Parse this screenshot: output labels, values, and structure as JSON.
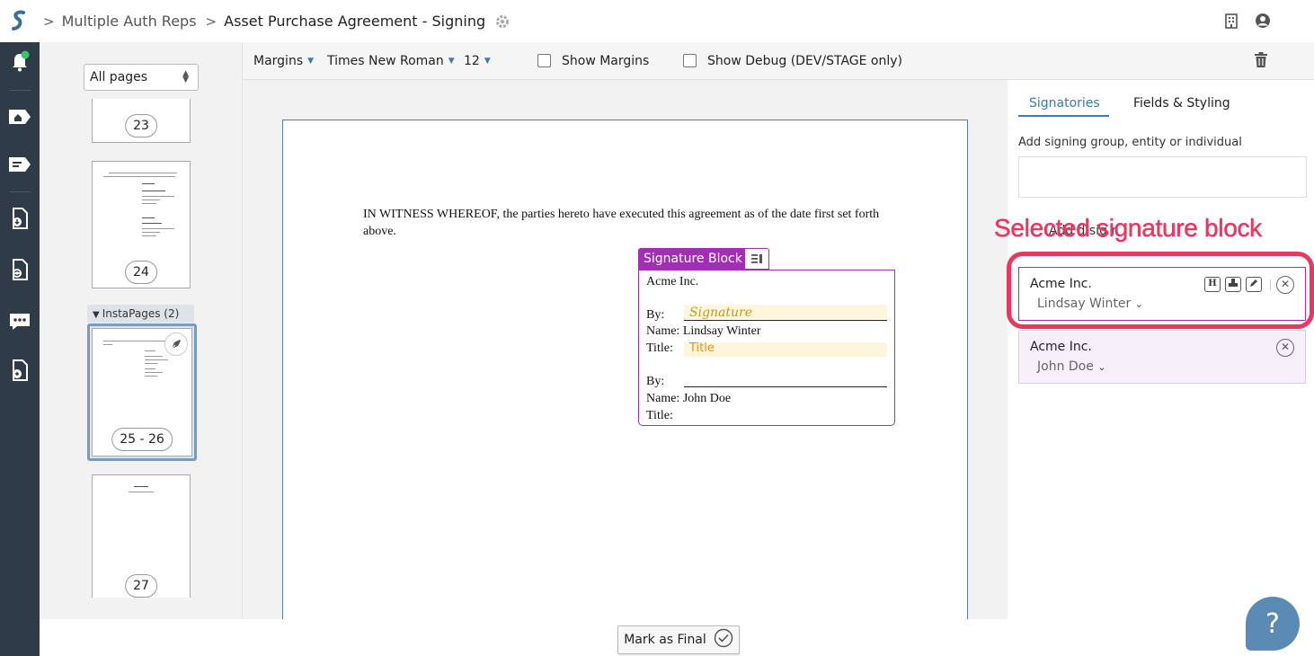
{
  "header": {
    "breadcrumb": [
      "Multiple Auth Reps",
      "Asset Purchase Agreement - Signing"
    ],
    "separator": ">"
  },
  "thumbnails": {
    "page_filter": "All pages",
    "pages": [
      "23",
      "24",
      "25 - 26",
      "27"
    ],
    "instapages_label": "InstaPages (2)"
  },
  "toolbar": {
    "margins": "Margins",
    "font": "Times New Roman",
    "size": "12",
    "show_margins": "Show Margins",
    "show_debug": "Show Debug (DEV/STAGE only)"
  },
  "document": {
    "witness": "IN WITNESS WHEREOF, the parties hereto have executed this agreement as of the date first set forth above.",
    "block_label": "Signature Block",
    "entity": "Acme Inc.",
    "by": "By:",
    "signature_placeholder": "Signature",
    "name1": "Name: Lindsay Winter",
    "title_label": "Title:",
    "title_placeholder": "Title",
    "name2": "Name: John Doe"
  },
  "actions": {
    "mark_final": "Mark as Final"
  },
  "right_panel": {
    "tabs": [
      "Signatories",
      "Fields & Styling"
    ],
    "add_label": "Add signing group, entity or individual",
    "obscured_text": "Add d sig r",
    "signers": [
      {
        "entity": "Acme Inc.",
        "person": "Lindsay Winter"
      },
      {
        "entity": "Acme Inc.",
        "person": "John Doe"
      }
    ],
    "signer_buttons": [
      "H"
    ]
  },
  "annotation": "Selected signature block",
  "help": "?"
}
